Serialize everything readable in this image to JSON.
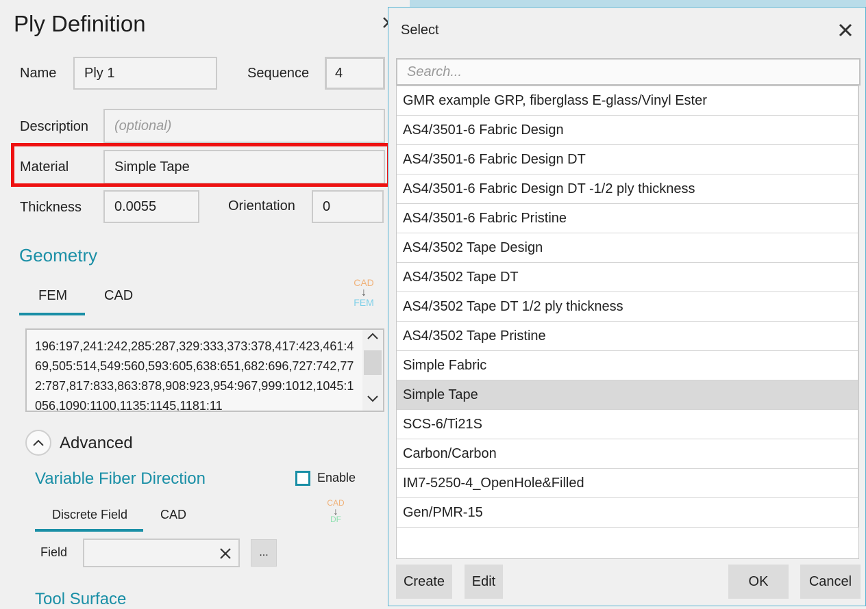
{
  "ply": {
    "title": "Ply Definition",
    "name_label": "Name",
    "name_value": "Ply 1",
    "sequence_label": "Sequence",
    "sequence_value": "4",
    "description_label": "Description",
    "description_placeholder": "(optional)",
    "material_label": "Material",
    "material_value": "Simple Tape",
    "thickness_label": "Thickness",
    "thickness_value": "0.0055",
    "orientation_label": "Orientation",
    "orientation_value": "0"
  },
  "geometry": {
    "heading": "Geometry",
    "tabs": [
      {
        "label": "FEM",
        "active": true
      },
      {
        "label": "CAD",
        "active": false
      }
    ],
    "cad_to_fem": {
      "top": "CAD",
      "arrow": "↓",
      "bottom": "FEM"
    },
    "elements": "196:197,241:242,285:287,329:333,373:378,417:423,461:469,505:514,549:560,593:605,638:651,682:696,727:742,772:787,817:833,863:878,908:923,954:967,999:1012,1045:1056,1090:1100,1135:1145,1181:11"
  },
  "advanced": {
    "label": "Advanced",
    "vfd_heading": "Variable Fiber Direction",
    "enable_label": "Enable",
    "enable_checked": false,
    "tabs": [
      {
        "label": "Discrete Field",
        "active": true
      },
      {
        "label": "CAD",
        "active": false
      }
    ],
    "cad_to_df": {
      "top": "CAD",
      "arrow": "↓",
      "bottom": "DF"
    },
    "field_label": "Field",
    "field_value": "",
    "browse_label": "...",
    "tool_surface_heading": "Tool Surface"
  },
  "select_dialog": {
    "title": "Select",
    "search_placeholder": "Search...",
    "items": [
      "GMR example GRP, fiberglass E-glass/Vinyl Ester",
      "AS4/3501-6 Fabric Design",
      "AS4/3501-6 Fabric Design DT",
      "AS4/3501-6 Fabric Design DT -1/2 ply thickness",
      "AS4/3501-6 Fabric Pristine",
      "AS4/3502 Tape Design",
      "AS4/3502 Tape DT",
      "AS4/3502 Tape DT 1/2 ply thickness",
      "AS4/3502 Tape Pristine",
      "Simple Fabric",
      "Simple Tape",
      "SCS-6/Ti21S",
      "Carbon/Carbon",
      "IM7-5250-4_OpenHole&Filled",
      "Gen/PMR-15"
    ],
    "selected_item": "Simple Tape",
    "buttons": {
      "create": "Create",
      "edit": "Edit",
      "ok": "OK",
      "cancel": "Cancel"
    }
  },
  "colors": {
    "accent": "#1a8fa6",
    "highlight_border": "#ee1111",
    "selected_row": "#d9d9d9",
    "dialog_border": "#56b4d3",
    "cad_label": "#f0b27a",
    "fem_label": "#7fd0e8",
    "df_label": "#8fe0b0"
  }
}
